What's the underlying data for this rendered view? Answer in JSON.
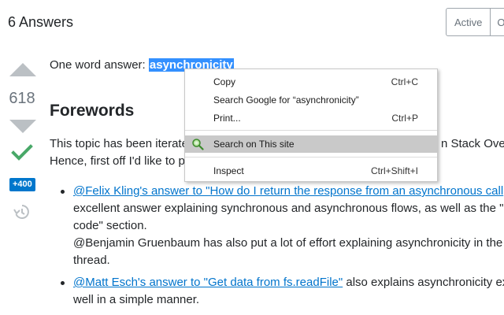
{
  "header": {
    "answers_title": "6 Answers",
    "sort_tabs": [
      "Active",
      "O"
    ]
  },
  "votes": {
    "count": "618",
    "bounty": "+400",
    "accepted": true
  },
  "post": {
    "intro_prefix": "One word answer: ",
    "intro_selected": "asynchronicity",
    "heading": "Forewords",
    "para_lines": [
      "This topic has been iterate",
      "Hence, first off I'd like to p"
    ],
    "para_tail": "n Stack Ove",
    "bullet1": {
      "link": "@Felix Kling's answer to \"How do I return the response from an asynchronous call",
      "lines": [
        "excellent answer explaining synchronous and asynchronous flows, as well as the \"",
        "code\" section.",
        "@Benjamin Gruenbaum has also put a lot of effort explaining asynchronicity in the",
        "thread."
      ]
    },
    "bullet2": {
      "link": "@Matt Esch's answer to \"Get data from fs.readFile\"",
      "after_link": " also explains asynchronicity ex",
      "lines": [
        "well in a simple manner."
      ]
    }
  },
  "context_menu": {
    "items": [
      {
        "label": "Copy",
        "shortcut": "Ctrl+C"
      },
      {
        "label": "Search Google for “asynchronicity”",
        "shortcut": ""
      },
      {
        "label": "Print...",
        "shortcut": "Ctrl+P"
      },
      {
        "label": "Search on This site",
        "shortcut": "",
        "highlighted": true,
        "icon": "search-site-icon"
      },
      {
        "label": "Inspect",
        "shortcut": "Ctrl+Shift+I"
      }
    ]
  },
  "colors": {
    "selection": "#3390ff",
    "link": "#0074cc",
    "accepted_check": "#48a868",
    "bounty": "#0077cc",
    "vote_arrow": "#bbc0c4",
    "menu_highlight": "#c9c9c9"
  }
}
